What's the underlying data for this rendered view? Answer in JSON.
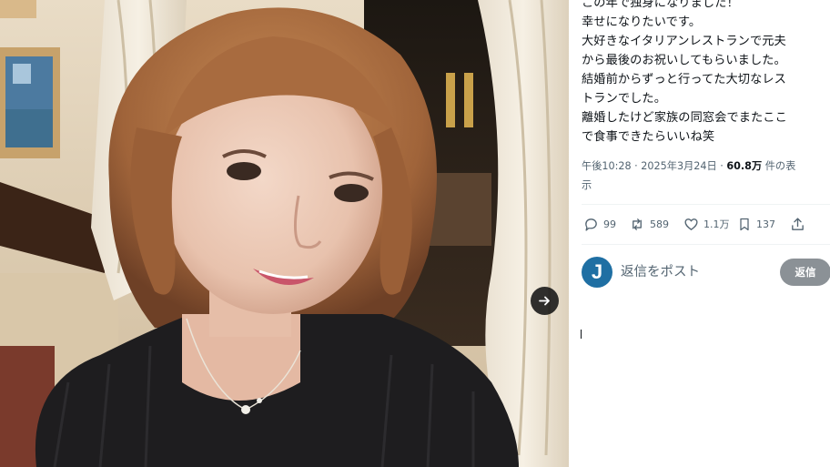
{
  "photo": {
    "description_icon": "selfie-photo",
    "next_icon": "arrow-right-icon"
  },
  "post": {
    "lines": [
      "この年で独身になりました！",
      "幸せになりたいです。",
      "大好きなイタリアンレストランで元夫",
      "から最後のお祝いしてもらいました。",
      "結婚前からずっと行ってた大切なレス",
      "トランでした。",
      "離婚したけど家族の同窓会でまたここ",
      "で食事できたらいいね笑"
    ],
    "time": "午後10:28",
    "separator": " · ",
    "date": "2025年3月24日",
    "views_count": "60.8万",
    "views_label": " 件の表",
    "views_label_2": "示"
  },
  "stats": {
    "replies": "99",
    "reposts": "589",
    "likes": "1.1万",
    "bookmarks": "137"
  },
  "reply": {
    "avatar_letter": "J",
    "placeholder": "返信をポスト",
    "button_label": "返信"
  },
  "colors": {
    "text": "#0f1419",
    "secondary": "#536471",
    "reply_button": "#8b9196",
    "avatar": "#1f6fa3"
  }
}
